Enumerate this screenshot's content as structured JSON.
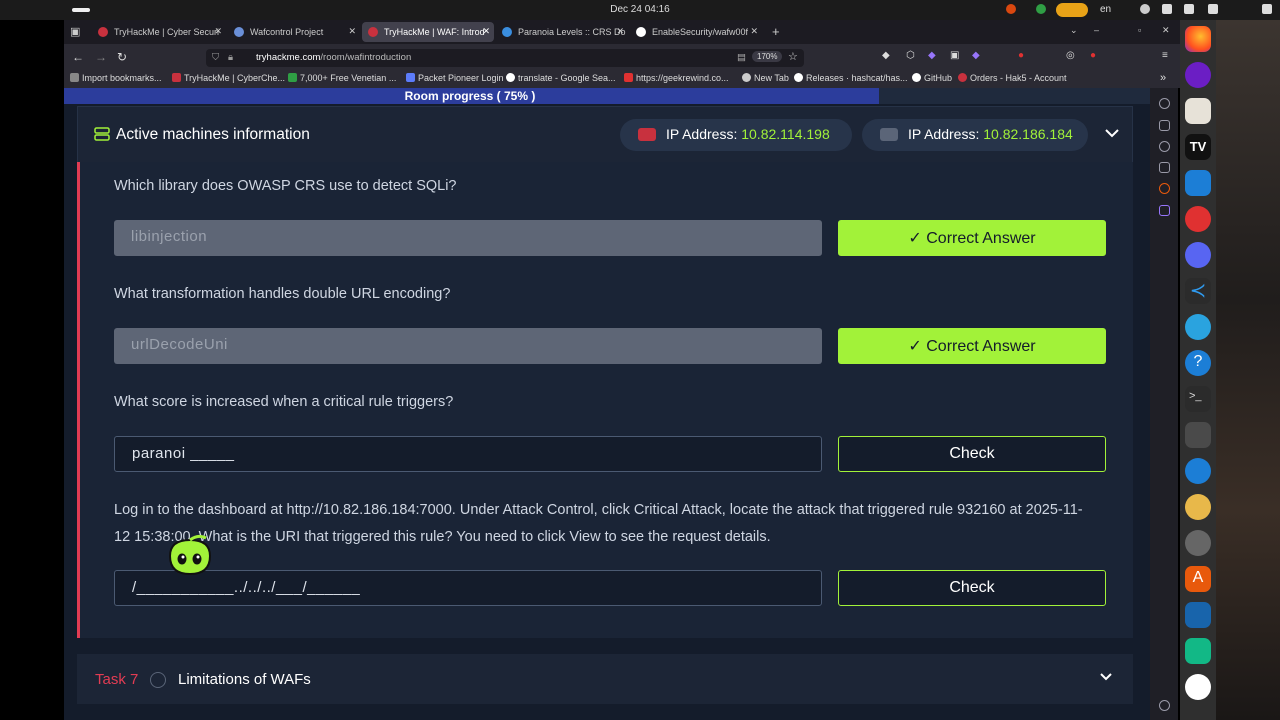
{
  "system": {
    "clock": "Dec 24  04:16",
    "language": "en"
  },
  "browser": {
    "tabs": [
      {
        "label": "TryHackMe | Cyber Securi",
        "active": false,
        "color": "#c8313e"
      },
      {
        "label": "Wafcontrol Project",
        "active": false,
        "color": "#6a8fd8"
      },
      {
        "label": "TryHackMe | WAF: Introd",
        "active": true,
        "color": "#c8313e"
      },
      {
        "label": "Paranoia Levels :: CRS Do",
        "active": false,
        "color": "#3a8ee0"
      },
      {
        "label": "EnableSecurity/wafw00f",
        "active": false,
        "color": "#ffffff"
      }
    ],
    "url_prefix": "tryhackme.com",
    "url_path": "/room/wafintroduction",
    "zoom": "170%",
    "bookmarks": [
      {
        "label": "Import bookmarks...",
        "color": "#888"
      },
      {
        "label": "TryHackMe | CyberChe...",
        "color": "#c8313e"
      },
      {
        "label": "7,000+ Free Venetian ...",
        "color": "#2f9e44"
      },
      {
        "label": "Packet Pioneer Login",
        "color": "#5c7cfa"
      },
      {
        "label": "translate - Google Sea...",
        "color": "#fff"
      },
      {
        "label": "https://geekrewind.co...",
        "color": "#e03131"
      },
      {
        "label": "New Tab",
        "color": "#ccc"
      },
      {
        "label": "Releases · hashcat/has...",
        "color": "#fff"
      },
      {
        "label": "GitHub",
        "color": "#fff"
      },
      {
        "label": "Orders - Hak5 - Account",
        "color": "#c8313e"
      }
    ]
  },
  "page": {
    "progress_label": "Room progress ( 75% )",
    "progress_fraction": 0.75,
    "machines": {
      "title": "Active machines information",
      "ip_label": "IP Address:",
      "ip1": "10.82.114.198",
      "ip2": "10.82.186.184"
    },
    "questions": [
      {
        "text": "Which library does OWASP CRS use to detect SQLi?",
        "answer": "libinjection",
        "button": "✓  Correct Answer",
        "state": "done"
      },
      {
        "text": "What transformation handles double URL encoding?",
        "answer": "urlDecodeUni",
        "button": "✓  Correct Answer",
        "state": "done"
      },
      {
        "text": "What score is increased when a critical rule triggers?",
        "answer": "paranoi _____",
        "button": "Check",
        "state": "open"
      },
      {
        "text": "Log in to the dashboard at http://10.82.186.184:7000. Under Attack Control, click Critical Attack, locate the attack that triggered rule 932160 at 2025-11-12 15:38:00. What is the URI that triggered this rule? You need to click View to see the request details.",
        "answer": "/___________../../../___/______",
        "button": "Check",
        "state": "open"
      }
    ],
    "next_task": {
      "number": "Task 7",
      "title": "Limitations of WAFs"
    },
    "colors": {
      "accent_green": "#a2f239",
      "accent_red": "#e23c53",
      "bg": "#141c2b"
    }
  }
}
